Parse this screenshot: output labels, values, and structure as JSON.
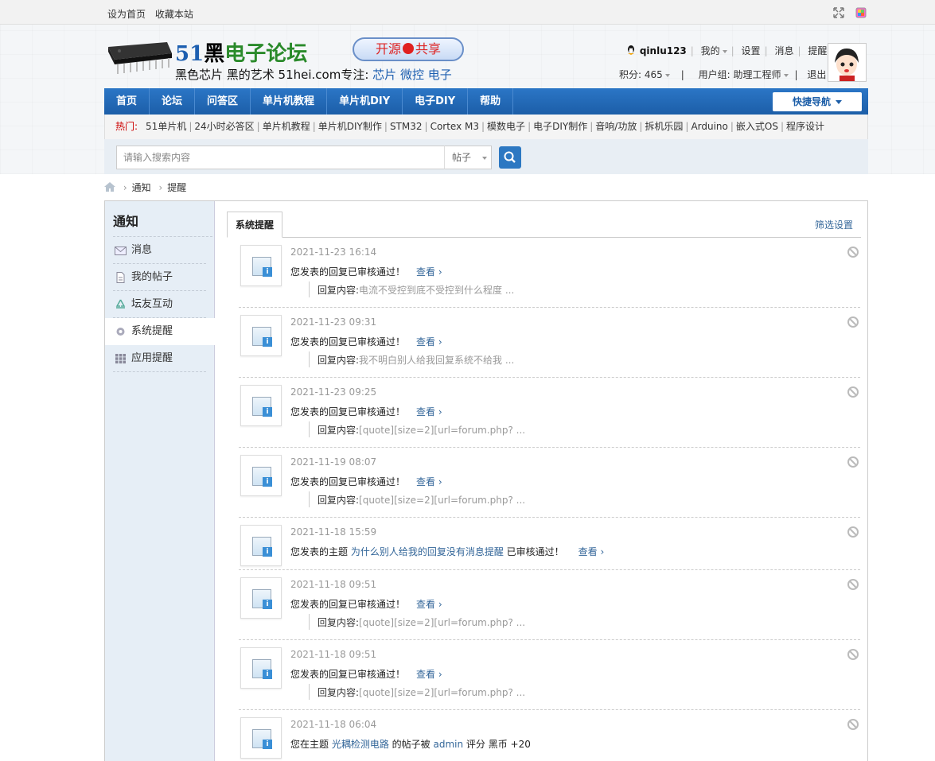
{
  "topbar": {
    "set_home": "设为首页",
    "bookmark": "收藏本站"
  },
  "logo": {
    "num": "51",
    "hei": "黑",
    "forum": "电子论坛",
    "badge_left": "开源",
    "badge_right": "共享",
    "sub_prefix": "黑色芯片 黑的艺术  51hei.com专注: ",
    "sub_chip": "芯片",
    "sub_mcu": "微控",
    "sub_elec": "电子"
  },
  "user": {
    "name": "qinlu123",
    "mine": "我的",
    "settings": "设置",
    "messages": "消息",
    "reminders": "提醒",
    "points": "积分: 465",
    "group": "用户组: 助理工程师",
    "logout": "退出"
  },
  "nav": {
    "items": [
      "首页",
      "论坛",
      "问答区",
      "单片机教程",
      "单片机DIY",
      "电子DIY",
      "帮助"
    ],
    "quick": "快捷导航"
  },
  "hot": {
    "label": "热门:",
    "items": [
      "51单片机",
      "24小时必答区",
      "单片机教程",
      "单片机DIY制作",
      "STM32",
      "Cortex M3",
      "模数电子",
      "电子DIY制作",
      "音响/功放",
      "拆机乐园",
      "Arduino",
      "嵌入式OS",
      "程序设计"
    ]
  },
  "search": {
    "placeholder": "请输入搜索内容",
    "type": "帖子"
  },
  "breadcrumb": {
    "notify": "通知",
    "remind": "提醒"
  },
  "sidebar": {
    "title": "通知",
    "items": [
      "消息",
      "我的帖子",
      "坛友互动",
      "系统提醒",
      "应用提醒"
    ]
  },
  "tabs": {
    "active": "系统提醒",
    "filter": "筛选设置"
  },
  "notices": [
    {
      "time": "2021-11-23 16:14",
      "msg": "您发表的回复已审核通过！",
      "view": "查看 ›",
      "quote_label": "回复内容:",
      "quote": "电流不受控到底不受控到什么程度 ..."
    },
    {
      "time": "2021-11-23 09:31",
      "msg": "您发表的回复已审核通过！",
      "view": "查看 ›",
      "quote_label": "回复内容:",
      "quote": "我不明白别人给我回复系统不给我 ..."
    },
    {
      "time": "2021-11-23 09:25",
      "msg": "您发表的回复已审核通过！",
      "view": "查看 ›",
      "quote_label": "回复内容:",
      "quote": "[quote][size=2][url=forum.php? ..."
    },
    {
      "time": "2021-11-19 08:07",
      "msg": "您发表的回复已审核通过！",
      "view": "查看 ›",
      "quote_label": "回复内容:",
      "quote": "[quote][size=2][url=forum.php? ..."
    },
    {
      "time": "2021-11-18 15:59",
      "msg_prefix": "您发表的主题 ",
      "msg_link": "为什么别人给我的回复没有消息提醒",
      "msg_suffix": " 已审核通过！",
      "view": "查看 ›"
    },
    {
      "time": "2021-11-18 09:51",
      "msg": "您发表的回复已审核通过！",
      "view": "查看 ›",
      "quote_label": "回复内容:",
      "quote": "[quote][size=2][url=forum.php? ..."
    },
    {
      "time": "2021-11-18 09:51",
      "msg": "您发表的回复已审核通过！",
      "view": "查看 ›",
      "quote_label": "回复内容:",
      "quote": "[quote][size=2][url=forum.php? ..."
    },
    {
      "time": "2021-11-18 06:04",
      "msg_prefix": "您在主题 ",
      "msg_link": "光耦检测电路",
      "msg_mid": " 的帖子被 ",
      "msg_user": "admin",
      "msg_suffix": " 评分 黑币 +20"
    }
  ]
}
